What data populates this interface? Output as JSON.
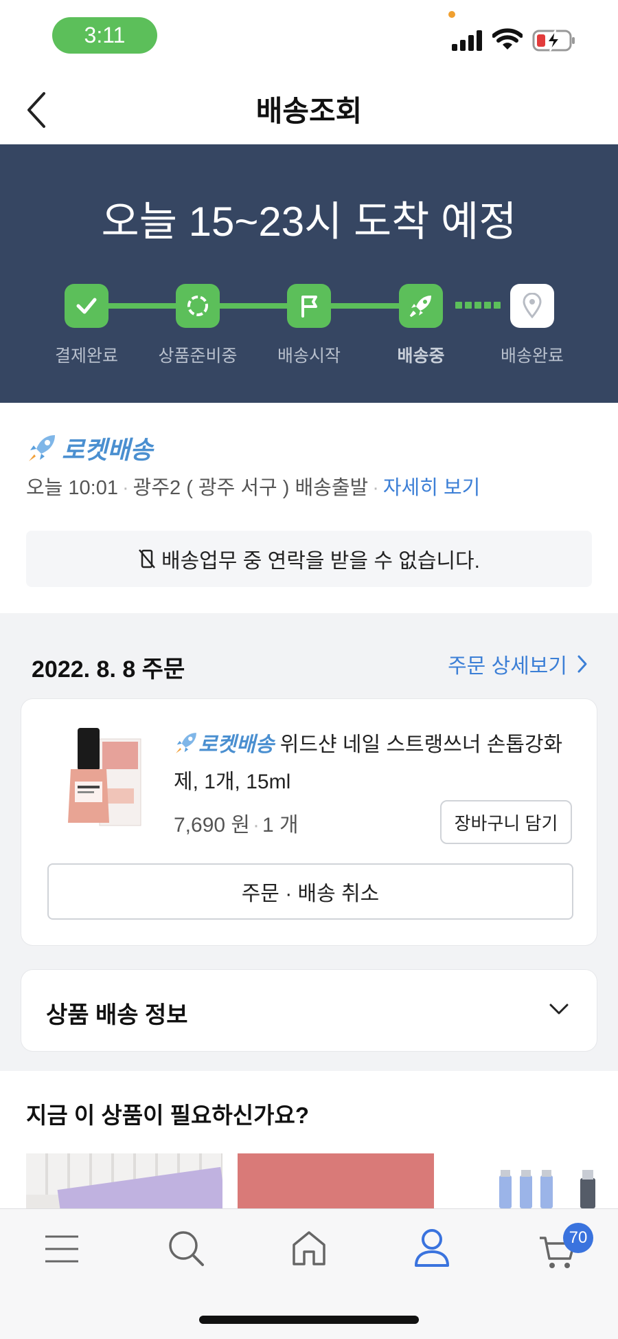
{
  "status_bar": {
    "time": "3:11"
  },
  "header": {
    "title": "배송조회"
  },
  "hero": {
    "eta": "오늘 15~23시 도착 예정",
    "steps": [
      {
        "label": "결제완료",
        "icon": "check-icon",
        "state": "done"
      },
      {
        "label": "상품준비중",
        "icon": "loading-circle-icon",
        "state": "done"
      },
      {
        "label": "배송시작",
        "icon": "flag-icon",
        "state": "done"
      },
      {
        "label": "배송중",
        "icon": "rocket-icon",
        "state": "current"
      },
      {
        "label": "배송완료",
        "icon": "location-pin-icon",
        "state": "pending"
      }
    ],
    "colors": {
      "background": "#364662",
      "progress": "#5cbf5a"
    }
  },
  "delivery": {
    "brand": "로켓배송",
    "time": "오늘 10:01",
    "location": "광주2 ( 광주 서구 ) 배송출발",
    "detail_link": "자세히 보기",
    "notice": "배송업무 중 연락을 받을 수 없습니다."
  },
  "order": {
    "date": "2022. 8. 8 주문",
    "detail_link": "주문 상세보기",
    "item": {
      "brand": "로켓배송",
      "title": "위드샨 네일 스트랭쓰너 손톱강화제, 1개, 15ml",
      "price": "7,690 원",
      "qty": "1 개",
      "cart_button": "장바구니 담기"
    },
    "cancel_button": "주문 · 배송 취소"
  },
  "shipping_info": {
    "title": "상품 배송 정보"
  },
  "recommend": {
    "title": "지금 이 상품이 필요하신가요?"
  },
  "tabbar": {
    "items": [
      "menu-icon",
      "search-icon",
      "home-icon",
      "my-account-icon",
      "cart-icon"
    ],
    "cart_badge": "70",
    "accent": "#3a73de"
  }
}
